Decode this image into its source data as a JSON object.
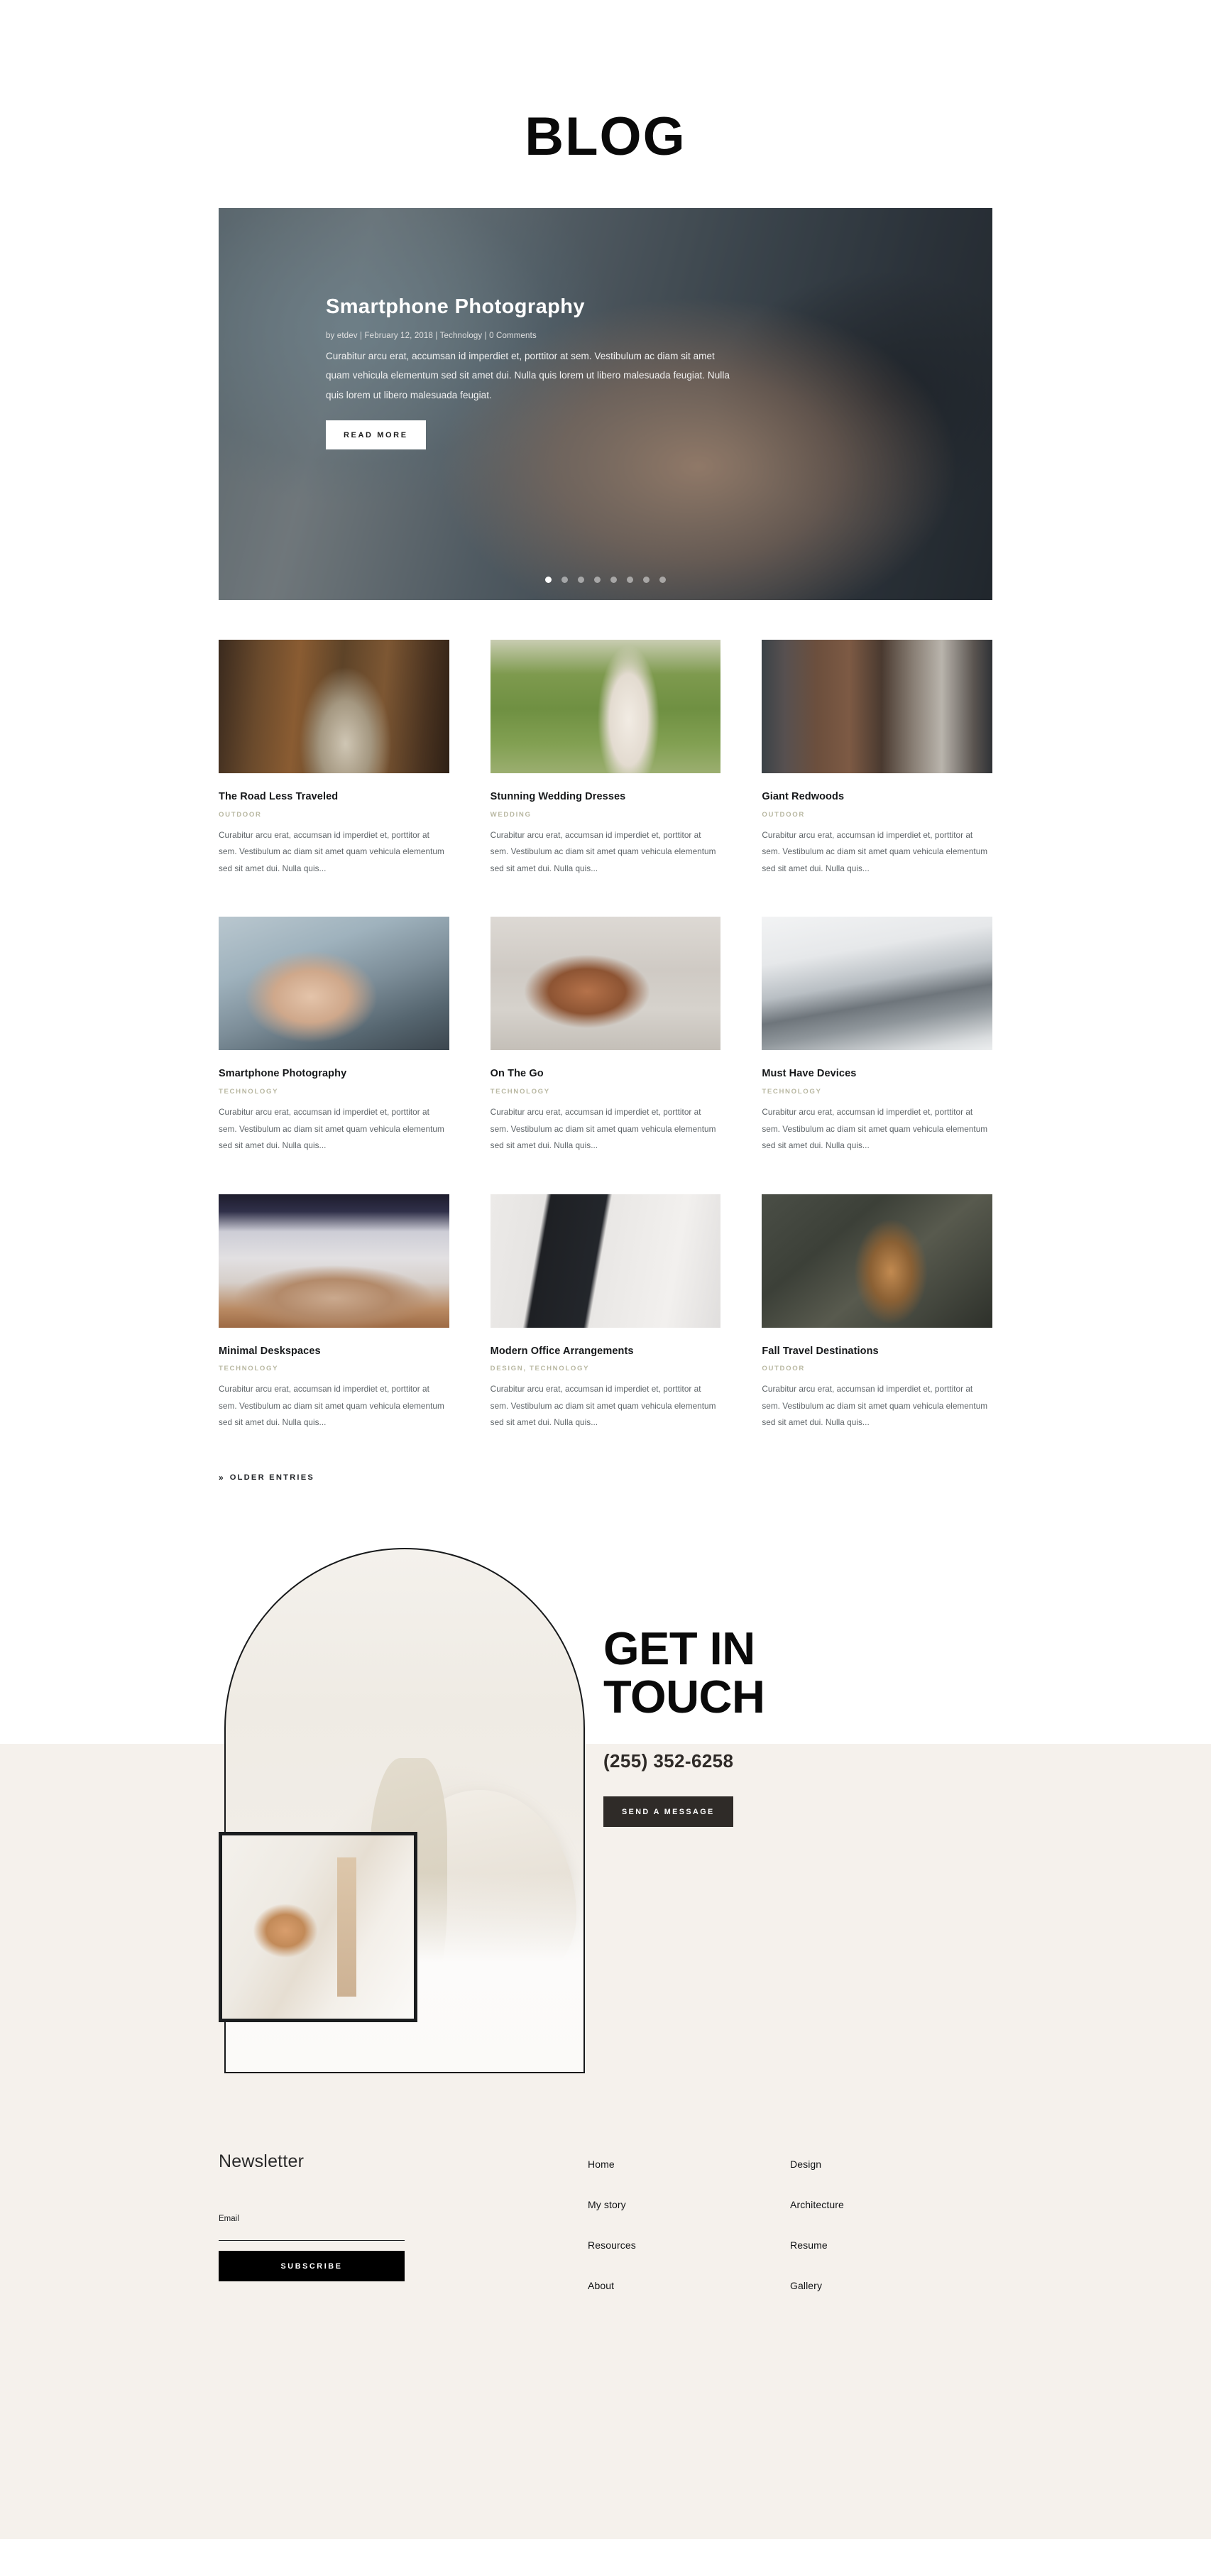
{
  "page": {
    "title": "BLOG"
  },
  "hero": {
    "title": "Smartphone Photography",
    "meta": "by etdev | February 12, 2018 | Technology | 0 Comments",
    "excerpt": "Curabitur arcu erat, accumsan id imperdiet et, porttitor at sem. Vestibulum ac diam sit amet quam vehicula elementum sed sit amet dui. Nulla quis lorem ut libero malesuada feugiat. Nulla quis lorem ut libero malesuada feugiat.",
    "button": "READ MORE",
    "slide_count": 8,
    "active_slide": 1
  },
  "posts": [
    {
      "title": "The Road Less Traveled",
      "category": "OUTDOOR",
      "excerpt": "Curabitur arcu erat, accumsan id imperdiet et, porttitor at sem. Vestibulum ac diam sit amet quam vehicula elementum sed sit amet dui. Nulla quis...",
      "thumb": "th-road"
    },
    {
      "title": "Stunning Wedding Dresses",
      "category": "WEDDING",
      "excerpt": "Curabitur arcu erat, accumsan id imperdiet et, porttitor at sem. Vestibulum ac diam sit amet quam vehicula elementum sed sit amet dui. Nulla quis...",
      "thumb": "th-wedding"
    },
    {
      "title": "Giant Redwoods",
      "category": "OUTDOOR",
      "excerpt": "Curabitur arcu erat, accumsan id imperdiet et, porttitor at sem. Vestibulum ac diam sit amet quam vehicula elementum sed sit amet dui. Nulla quis...",
      "thumb": "th-redwood"
    },
    {
      "title": "Smartphone Photography",
      "category": "TECHNOLOGY",
      "excerpt": "Curabitur arcu erat, accumsan id imperdiet et, porttitor at sem. Vestibulum ac diam sit amet quam vehicula elementum sed sit amet dui. Nulla quis...",
      "thumb": "th-smartphone"
    },
    {
      "title": "On The Go",
      "category": "TECHNOLOGY",
      "excerpt": "Curabitur arcu erat, accumsan id imperdiet et, porttitor at sem. Vestibulum ac diam sit amet quam vehicula elementum sed sit amet dui. Nulla quis...",
      "thumb": "th-onthego"
    },
    {
      "title": "Must Have Devices",
      "category": "TECHNOLOGY",
      "excerpt": "Curabitur arcu erat, accumsan id imperdiet et, porttitor at sem. Vestibulum ac diam sit amet quam vehicula elementum sed sit amet dui. Nulla quis...",
      "thumb": "th-devices"
    },
    {
      "title": "Minimal Deskspaces",
      "category": "TECHNOLOGY",
      "excerpt": "Curabitur arcu erat, accumsan id imperdiet et, porttitor at sem. Vestibulum ac diam sit amet quam vehicula elementum sed sit amet dui. Nulla quis...",
      "thumb": "th-deskspace"
    },
    {
      "title": "Modern Office Arrangements",
      "category": "DESIGN, TECHNOLOGY",
      "excerpt": "Curabitur arcu erat, accumsan id imperdiet et, porttitor at sem. Vestibulum ac diam sit amet quam vehicula elementum sed sit amet dui. Nulla quis...",
      "thumb": "th-office"
    },
    {
      "title": "Fall Travel Destinations",
      "category": "OUTDOOR",
      "excerpt": "Curabitur arcu erat, accumsan id imperdiet et, porttitor at sem. Vestibulum ac diam sit amet quam vehicula elementum sed sit amet dui. Nulla quis...",
      "thumb": "th-fall"
    }
  ],
  "pagination": {
    "chevron": "»",
    "older_label": "OLDER ENTRIES"
  },
  "contact": {
    "title_line1": "GET IN",
    "title_line2": "TOUCH",
    "phone": "(255) 352-6258",
    "button": "SEND A MESSAGE"
  },
  "newsletter": {
    "title": "Newsletter",
    "email_label": "Email",
    "email_value": "",
    "email_placeholder": "",
    "button": "SUBSCRIBE"
  },
  "footer": {
    "col1": [
      "Home",
      "My story",
      "Resources",
      "About"
    ],
    "col2": [
      "Design",
      "Architecture",
      "Resume",
      "Gallery"
    ]
  },
  "colors": {
    "accent_dark": "#2f2b28",
    "band_bg": "#f5f1ec",
    "category": "#b9b8a2",
    "text": "#16181a"
  }
}
